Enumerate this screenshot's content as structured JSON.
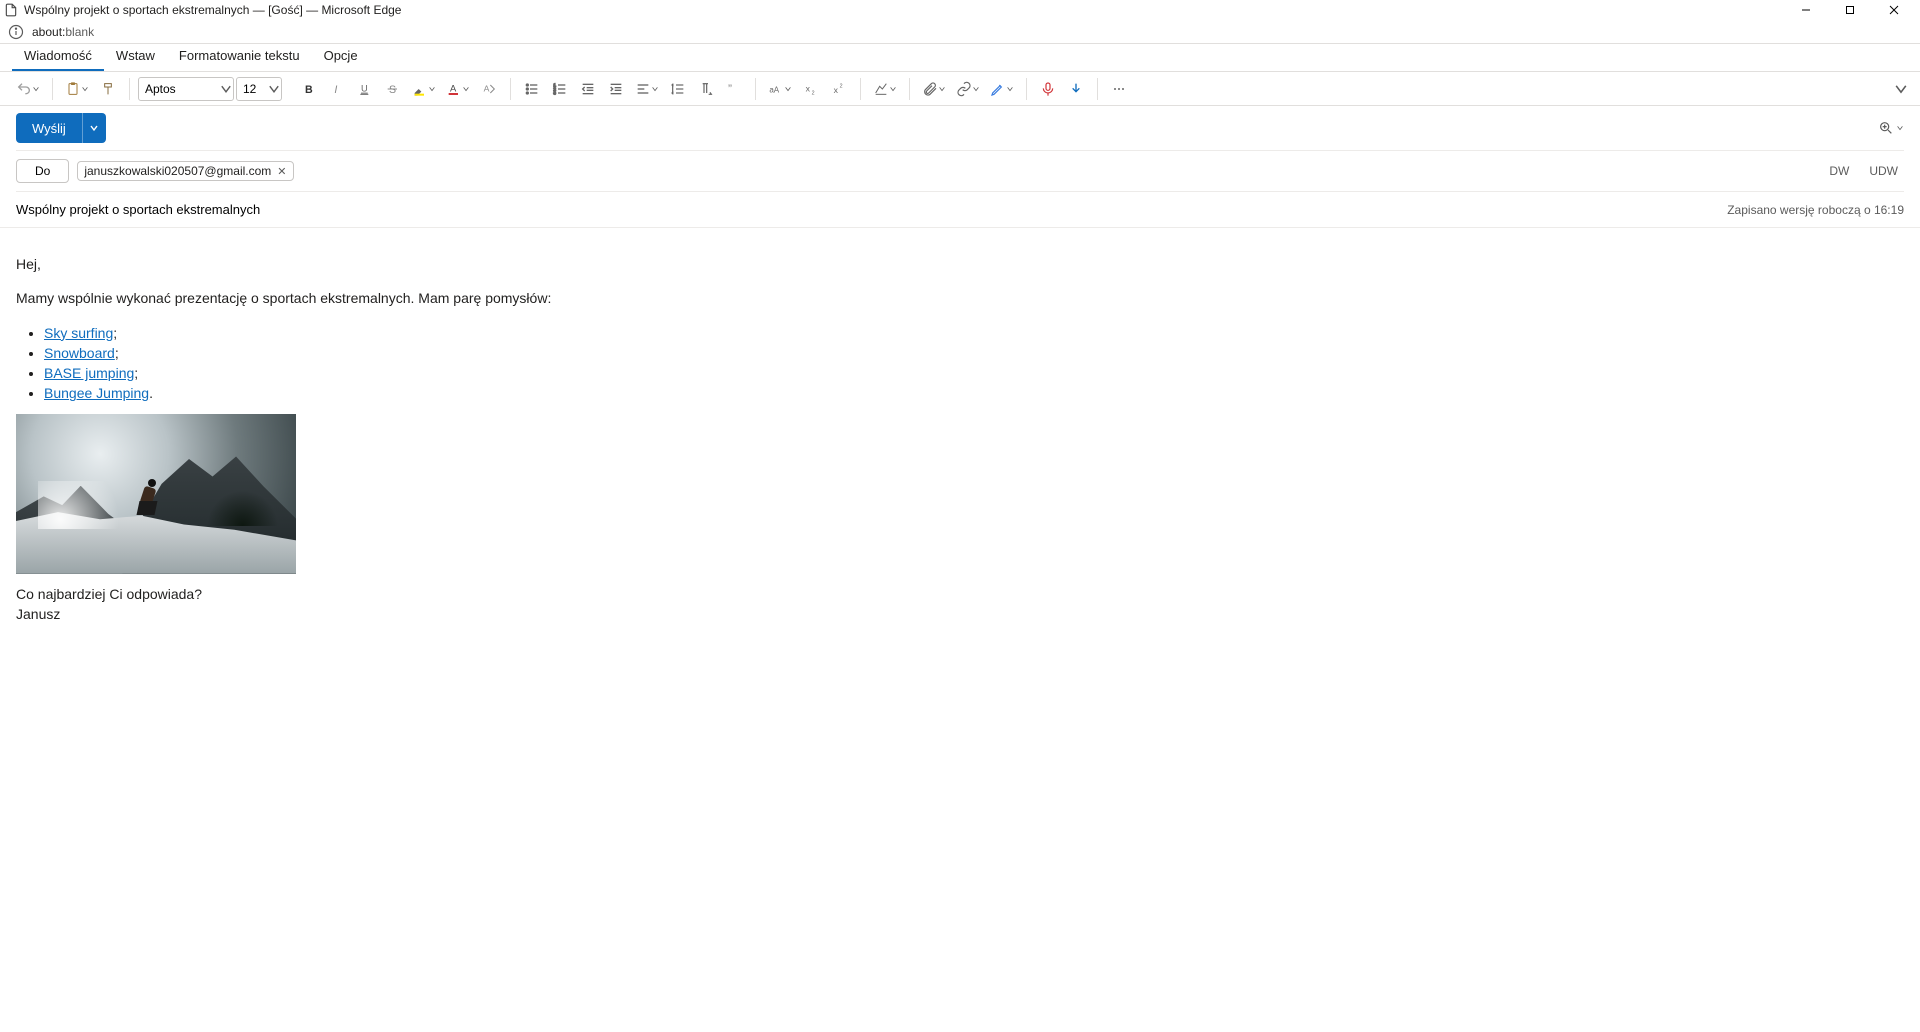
{
  "window": {
    "title": "Wspólny projekt o sportach ekstremalnych — [Gość] — Microsoft Edge"
  },
  "address": {
    "prefix": "about:",
    "suffix": "blank"
  },
  "tabs": [
    {
      "label": "Wiadomość",
      "active": true
    },
    {
      "label": "Wstaw"
    },
    {
      "label": "Formatowanie tekstu"
    },
    {
      "label": "Opcje"
    }
  ],
  "font": {
    "name": "Aptos",
    "size": "12"
  },
  "send": {
    "label": "Wyślij"
  },
  "to": {
    "label": "Do"
  },
  "recipients": [
    "januszkowalski020507@gmail.com"
  ],
  "cc": {
    "dw": "DW",
    "udw": "UDW"
  },
  "subject": {
    "value": "Wspólny projekt o sportach ekstremalnych"
  },
  "saved": "Zapisano wersję roboczą o 16:19",
  "body": {
    "greeting": "Hej,",
    "intro": "Mamy wspólnie wykonać prezentację o sportach ekstremalnych. Mam parę pomysłów:",
    "items": [
      {
        "text": "Sky surfing",
        "trail": ";"
      },
      {
        "text": "Snowboard",
        "trail": ";"
      },
      {
        "text": "BASE jumping",
        "trail": ";"
      },
      {
        "text": "Bungee Jumping",
        "trail": "."
      }
    ],
    "question": "Co najbardziej Ci odpowiada?",
    "signature": "Janusz"
  }
}
